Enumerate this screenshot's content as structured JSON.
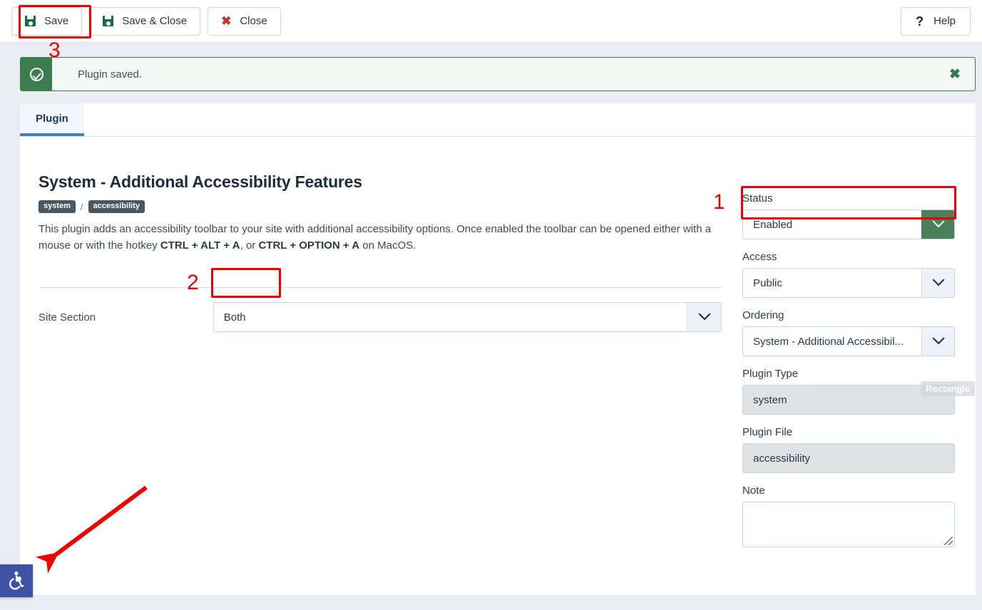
{
  "toolbar": {
    "save_label": "Save",
    "save_close_label": "Save & Close",
    "close_label": "Close",
    "help_label": "Help",
    "save_icon": "save-disk-icon",
    "close_icon": "close-x-icon",
    "help_icon": "question-mark-icon"
  },
  "alert": {
    "message": "Plugin saved.",
    "icon": "check-circle-icon",
    "close_glyph": "✖",
    "accent_color": "#3c7d4f",
    "background_color": "#f4f9f5"
  },
  "tabs": [
    {
      "label": "Plugin",
      "active": true
    }
  ],
  "plugin": {
    "title": "System - Additional Accessibility Features",
    "badges": [
      "system",
      "accessibility"
    ],
    "badge_separator": "/",
    "description_part1": "This plugin adds an accessibility toolbar to your site with additional accessibility options. Once enabled the toolbar can be opened either with a mouse or with the hotkey ",
    "hotkey_windows": "CTRL + ALT + A",
    "description_part2": ", or ",
    "hotkey_mac": "CTRL + OPTION + A",
    "description_part3": " on MacOS."
  },
  "form": {
    "site_section_label": "Site Section",
    "site_section_value": "Both"
  },
  "sidebar": {
    "status_label": "Status",
    "status_value": "Enabled",
    "access_label": "Access",
    "access_value": "Public",
    "ordering_label": "Ordering",
    "ordering_value": "System - Additional Accessibil...",
    "plugin_type_label": "Plugin Type",
    "plugin_type_value": "system",
    "plugin_file_label": "Plugin File",
    "plugin_file_value": "accessibility",
    "note_label": "Note",
    "note_value": ""
  },
  "annotations": {
    "step1": "1",
    "step2": "2",
    "step3": "3",
    "highlight_color": "#f10000",
    "arrow_color": "#f10000",
    "rect_tool_tooltip": "Rectangle"
  },
  "accessibility_widget": {
    "icon": "wheelchair-accessibility-icon",
    "color": "#3d52a5"
  }
}
